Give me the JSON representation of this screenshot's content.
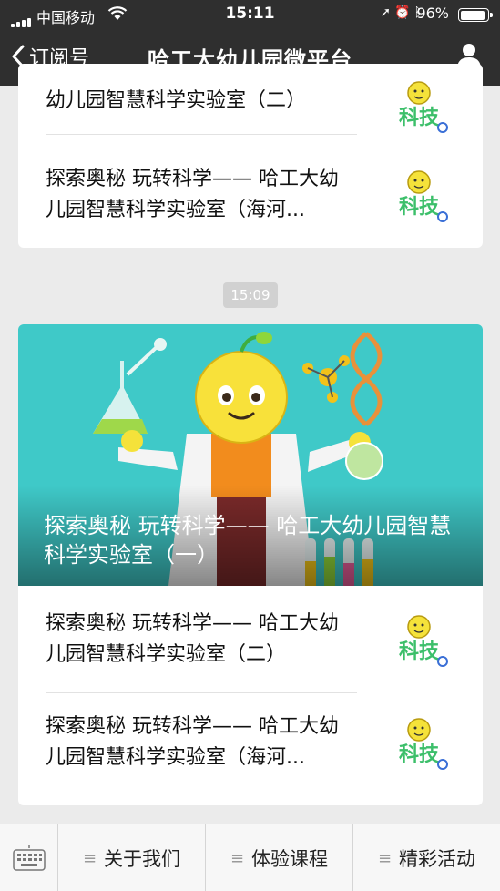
{
  "status_bar": {
    "carrier": "中国移动",
    "time": "15:11",
    "battery_pct": "96%",
    "battery_level": 0.96,
    "icons": [
      "signal-icon",
      "wifi-icon",
      "location-icon",
      "alarm-icon",
      "bluetooth-icon",
      "battery-icon"
    ]
  },
  "nav": {
    "back_label": "订阅号",
    "title": "哈工大幼儿园微平台",
    "right_icon": "profile-icon"
  },
  "messages": [
    {
      "items": [
        {
          "title": "幼儿园智慧科学实验室（二）",
          "thumb_icon": "science-logo-icon"
        },
        {
          "title": "探索奥秘 玩转科学—— 哈工大幼儿园智慧科学实验室（海河...",
          "thumb_icon": "science-logo-icon"
        }
      ]
    },
    {
      "time": "15:09",
      "cover": {
        "title": "探索奥秘 玩转科学—— 哈工大幼儿园智慧科学实验室（一）"
      },
      "items": [
        {
          "title": "探索奥秘 玩转科学—— 哈工大幼儿园智慧科学实验室（二）",
          "thumb_icon": "science-logo-icon"
        },
        {
          "title": "探索奥秘 玩转科学—— 哈工大幼儿园智慧科学实验室（海河...",
          "thumb_icon": "science-logo-icon"
        }
      ]
    }
  ],
  "menu": {
    "keyboard_icon": "keyboard-icon",
    "items": [
      {
        "label": "关于我们",
        "icon": "menu-lines-icon"
      },
      {
        "label": "体验课程",
        "icon": "menu-lines-icon"
      },
      {
        "label": "精彩活动",
        "icon": "menu-lines-icon"
      }
    ]
  },
  "colors": {
    "nav_bg": "#2f2f2f",
    "page_bg": "#ebebeb",
    "hero_bg": "#3fc9c8"
  }
}
